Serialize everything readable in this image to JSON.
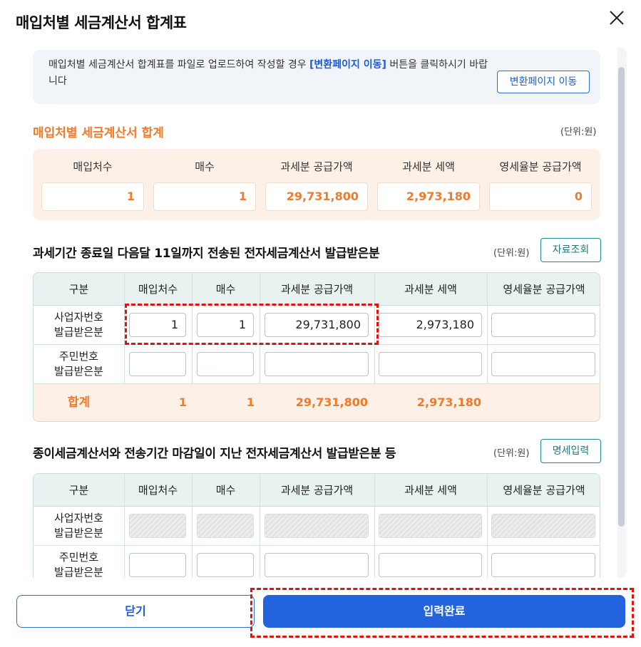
{
  "dialog": {
    "title": "매입처별 세금계산서 합계표"
  },
  "notice": {
    "text_before": "매입처별 세금계산서 합계표를 파일로 업로드하여 작성할 경우 ",
    "text_highlight": "[변환페이지 이동]",
    "text_after": " 버튼을 클릭하시기 바랍니다",
    "button": "변환페이지 이동"
  },
  "summary": {
    "title": "매입처별 세금계산서 합계",
    "unit": "(단위:원)",
    "headers": [
      "매입처수",
      "매수",
      "과세분 공급가액",
      "과세분 세액",
      "영세율분 공급가액"
    ],
    "values": [
      "1",
      "1",
      "29,731,800",
      "2,973,180",
      "0"
    ]
  },
  "section1": {
    "title": "과세기간 종료일 다음달 11일까지 전송된 전자세금계산서 발급받은분",
    "unit": "(단위:원)",
    "button": "자료조회",
    "headers": [
      "구분",
      "매입처수",
      "매수",
      "과세분 공급가액",
      "과세분 세액",
      "영세율분 공급가액"
    ],
    "rows": [
      {
        "label1": "사업자번호",
        "label2": "발급받은분",
        "values": [
          "1",
          "1",
          "29,731,800",
          "2,973,180",
          ""
        ]
      },
      {
        "label1": "주민번호",
        "label2": "발급받은분",
        "values": [
          "",
          "",
          "",
          "",
          ""
        ]
      }
    ],
    "total": {
      "label": "합계",
      "values": [
        "1",
        "1",
        "29,731,800",
        "2,973,180",
        ""
      ]
    }
  },
  "section2": {
    "title": "종이세금계산서와 전송기간 마감일이 지난 전자세금계산서 발급받은분 등",
    "unit": "(단위:원)",
    "button": "명세입력",
    "headers": [
      "구분",
      "매입처수",
      "매수",
      "과세분 공급가액",
      "과세분 세액",
      "영세율분 공급가액"
    ],
    "rows": [
      {
        "label1": "사업자번호",
        "label2": "발급받은분"
      },
      {
        "label1": "주민번호",
        "label2": "발급받은분"
      }
    ]
  },
  "footer": {
    "close": "닫기",
    "submit": "입력완료"
  },
  "colors": {
    "accent_orange": "#f07a2a",
    "primary_blue": "#2463de",
    "teal": "#1f8a8a",
    "highlight_red": "#e0140e"
  }
}
